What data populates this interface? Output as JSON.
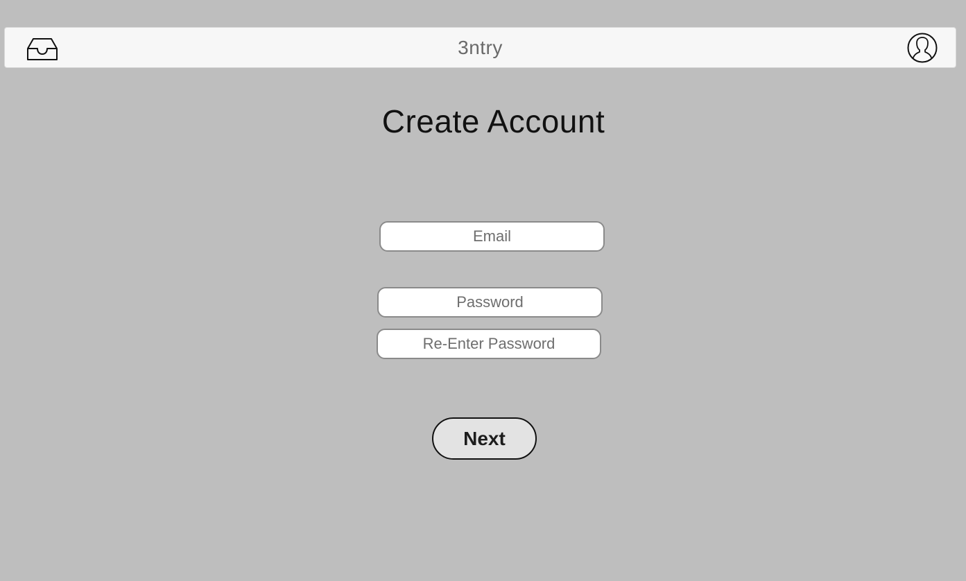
{
  "header": {
    "app_title": "3ntry",
    "left_icon": "inbox-icon",
    "right_icon": "user-profile-icon"
  },
  "page": {
    "title": "Create Account"
  },
  "form": {
    "email_placeholder": "Email",
    "password_placeholder": "Password",
    "reenter_password_placeholder": "Re-Enter Password",
    "next_label": "Next"
  },
  "colors": {
    "background": "#bebebe",
    "header_background": "#f7f7f7",
    "button_background": "#e3e3e3"
  }
}
